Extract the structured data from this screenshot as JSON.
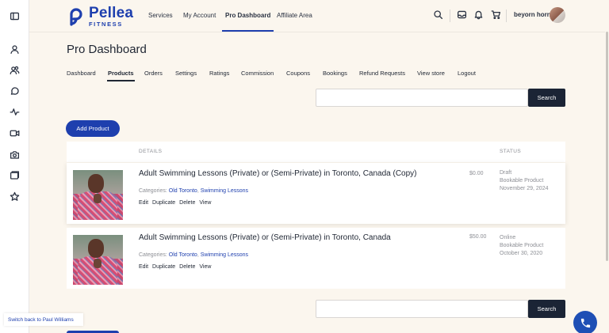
{
  "brand": {
    "name": "Pellea",
    "sub": "FITNESS",
    "color": "#1e3fae"
  },
  "topnav": {
    "items": [
      "Services",
      "My Account",
      "Pro Dashboard",
      "Affiliate Area"
    ],
    "active": "Pro Dashboard"
  },
  "header_icons": [
    "search-icon",
    "inbox-icon",
    "bell-icon",
    "cart-icon"
  ],
  "user": {
    "name": "beyorn horn"
  },
  "page_title": "Pro Dashboard",
  "tabs": {
    "items": [
      "Dashboard",
      "Products",
      "Orders",
      "Settings",
      "Ratings",
      "Commission",
      "Coupons",
      "Bookings",
      "Refund Requests",
      "View store",
      "Logout"
    ],
    "active": "Products"
  },
  "search": {
    "button_label": "Search",
    "value": ""
  },
  "add_product_label": "Add Product",
  "table": {
    "headers": {
      "details": "DETAILS",
      "status": "STATUS"
    },
    "rows": [
      {
        "title": "Adult Swimming Lessons (Private) or (Semi-Private) in Toronto, Canada (Copy)",
        "price": "$0.00",
        "categories_label": "Categories:",
        "categories": [
          "Old Toronto",
          "Swimming Lessons"
        ],
        "actions": [
          "Edit",
          "Duplicate",
          "Delete",
          "View"
        ],
        "status": "Draft",
        "type": "Bookable Product",
        "date": "November 29, 2024"
      },
      {
        "title": "Adult Swimming Lessons (Private) or (Semi-Private) in Toronto, Canada",
        "price": "$50.00",
        "categories_label": "Categories:",
        "categories": [
          "Old Toronto",
          "Swimming Lessons"
        ],
        "actions": [
          "Edit",
          "Duplicate",
          "Delete",
          "View"
        ],
        "status": "Online",
        "type": "Bookable Product",
        "date": "October 30, 2020"
      }
    ]
  },
  "bottom_search": {
    "button_label": "Search"
  },
  "switch_back_label": "Switch back to Paul Williams",
  "rail_icons": [
    "sidebar-toggle-icon",
    "user-icon",
    "users-icon",
    "chat-icon",
    "activity-icon",
    "video-icon",
    "camera-icon",
    "folder-icon",
    "star-icon"
  ],
  "colors": {
    "accent": "#1e3fae",
    "dark": "#1b2435",
    "page_bg": "#fbf6ee"
  }
}
